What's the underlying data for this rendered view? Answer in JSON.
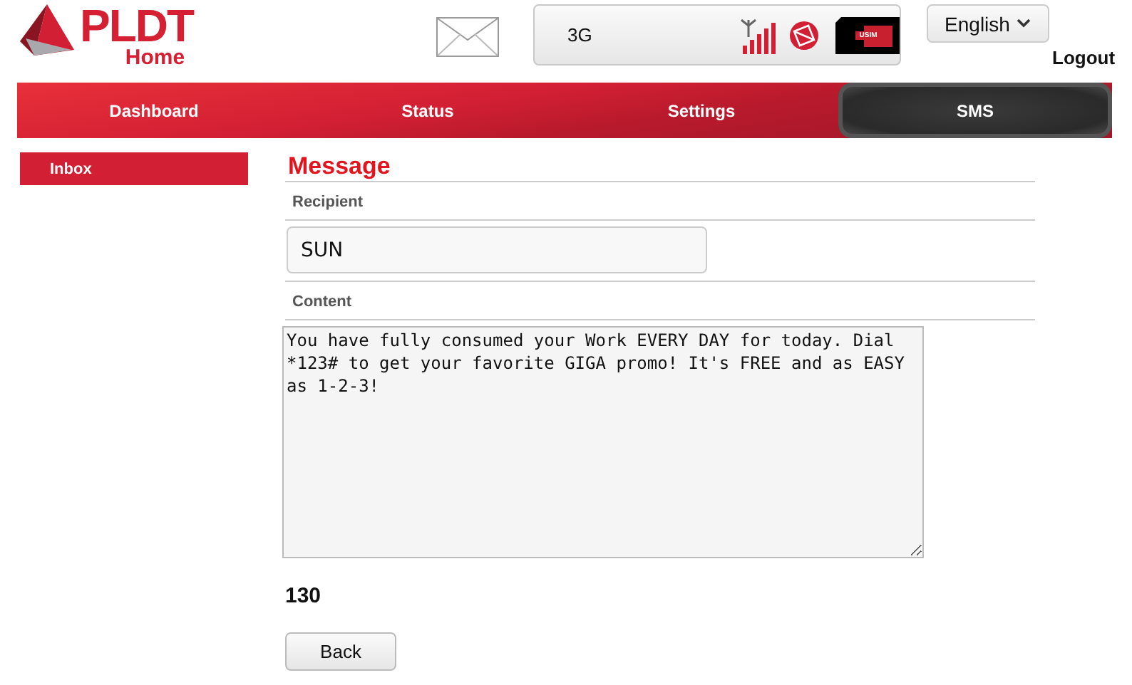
{
  "logo": {
    "brand": "PLDT",
    "sub": "Home"
  },
  "status": {
    "network": "3G",
    "sim_label": "USIM"
  },
  "language": {
    "label": "English"
  },
  "logout": "Logout",
  "tabs": [
    {
      "label": "Dashboard",
      "selected": false
    },
    {
      "label": "Status",
      "selected": false
    },
    {
      "label": "Settings",
      "selected": false
    },
    {
      "label": "SMS",
      "selected": true
    }
  ],
  "sidebar": {
    "items": [
      {
        "label": "Inbox",
        "selected": true
      }
    ]
  },
  "message": {
    "title": "Message",
    "recipient_label": "Recipient",
    "recipient": "SUN",
    "content_label": "Content",
    "content": "You have fully consumed your Work EVERY DAY for today. Dial *123# to get your favorite GIGA promo! It's FREE and as EASY as 1-2-3!",
    "count": "130",
    "back": "Back"
  }
}
